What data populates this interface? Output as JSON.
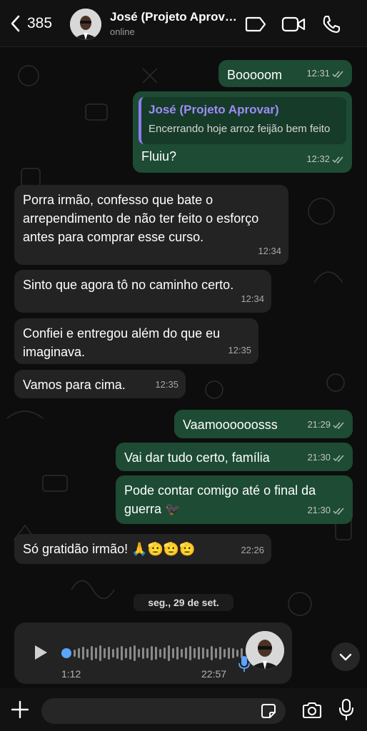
{
  "header": {
    "back_count": "385",
    "contact_name": "José (Projeto Aprovar)",
    "contact_status": "online"
  },
  "messages": [
    {
      "text": "Booooom",
      "time": "12:31",
      "direction": "out"
    },
    {
      "reply_to_name": "José (Projeto Aprovar)",
      "reply_to_text": "Encerrando hoje arroz feijão bem feito",
      "text": "Fluiu?",
      "time": "12:32",
      "direction": "out"
    },
    {
      "text": "Porra irmão, confesso que bate o arrependimento de não ter feito o esforço antes para comprar esse curso.",
      "time": "12:34",
      "direction": "in"
    },
    {
      "text": "Sinto que agora tô no caminho certo.",
      "time": "12:34",
      "direction": "in"
    },
    {
      "text": "Confiei e entregou além do que eu imaginava.",
      "time": "12:35",
      "direction": "in"
    },
    {
      "text": "Vamos para cima.",
      "time": "12:35",
      "direction": "in"
    },
    {
      "text": "Vaamoooooosss",
      "time": "21:29",
      "direction": "out"
    },
    {
      "text": "Vai dar tudo certo, família",
      "time": "21:30",
      "direction": "out"
    },
    {
      "text": "Pode contar comigo até o final da guerra 🐦‍⬛",
      "time": "21:30",
      "direction": "out"
    },
    {
      "text": "Só gratidão irmão! 🙏🫡🫡🫡",
      "time": "22:26",
      "direction": "in"
    }
  ],
  "date_separator": "seg., 29 de set.",
  "voice_draft": {
    "elapsed": "1:12",
    "recorded_at": "22:57"
  },
  "composer": {
    "placeholder": ""
  },
  "colors": {
    "outgoing_bubble": "#1d4b34",
    "incoming_bubble": "#232323",
    "read_ticks": "#a5b8ad",
    "quote_accent": "#8e7cf0",
    "waveform_progress": "#5aa6ff"
  },
  "icons": [
    "back-chevron-icon",
    "tag-icon",
    "video-call-icon",
    "phone-icon",
    "play-icon",
    "microphone-icon",
    "chevron-down-icon",
    "plus-icon",
    "sticker-icon",
    "camera-icon",
    "double-check-icon"
  ]
}
